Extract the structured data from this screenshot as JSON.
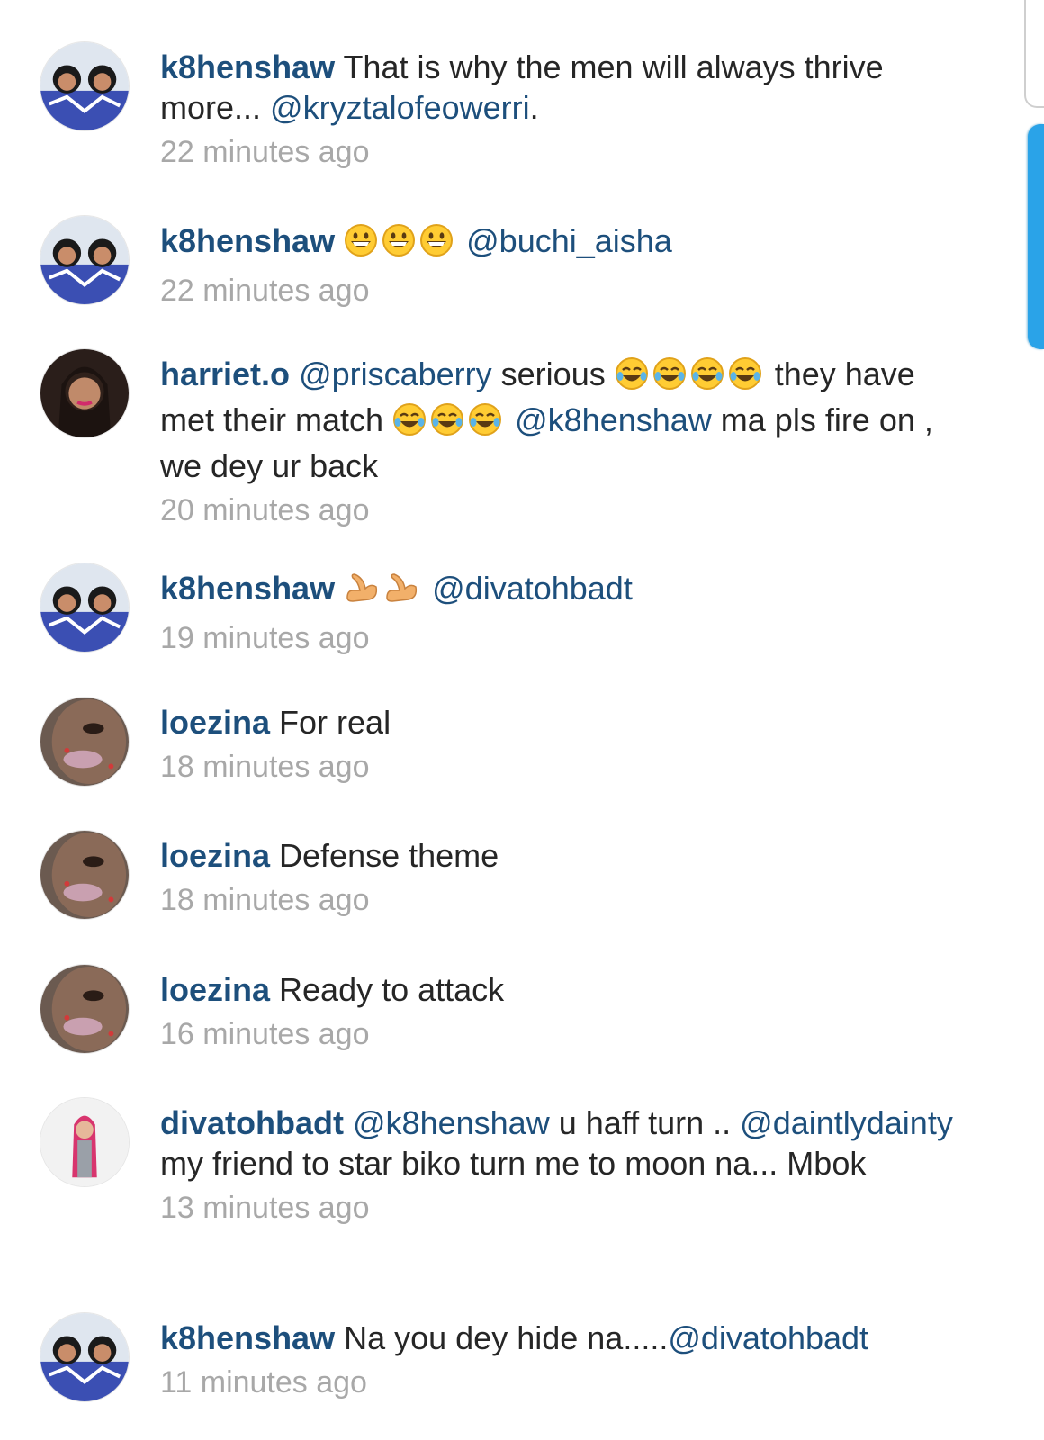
{
  "colors": {
    "username": "#1d4f7c",
    "mention": "#1d4f7c",
    "text": "#262626",
    "timestamp": "#a8a8a8",
    "scroll_thumb": "#2aa3e8"
  },
  "comments": [
    {
      "avatar": "k8henshaw-avatar",
      "user": "k8henshaw",
      "p1": " That is why the men will always thrive more... ",
      "m1": "@kryztalofeowerri",
      "p2": ".",
      "time": "22 minutes ago"
    },
    {
      "avatar": "k8henshaw-avatar",
      "user": "k8henshaw",
      "emoji": [
        "grinning-face-emoji",
        "grinning-face-emoji",
        "grinning-face-emoji"
      ],
      "m1": "@buchi_aisha",
      "time": "22 minutes ago"
    },
    {
      "avatar": "harriet-o-avatar",
      "user": "harriet.o",
      "m1": "@priscaberry",
      "p1": " serious ",
      "emoji_a": [
        "tears-of-joy-emoji",
        "tears-of-joy-emoji",
        "tears-of-joy-emoji",
        "tears-of-joy-emoji"
      ],
      "p2": " they have met their match ",
      "emoji_b": [
        "tears-of-joy-emoji",
        "tears-of-joy-emoji",
        "tears-of-joy-emoji"
      ],
      "m2": "@k8henshaw",
      "p3": " ma pls fire on , we dey ur back",
      "time": "20 minutes ago"
    },
    {
      "avatar": "k8henshaw-avatar",
      "user": "k8henshaw",
      "emoji": [
        "flexed-biceps-emoji",
        "flexed-biceps-emoji"
      ],
      "m1": "@divatohbadt",
      "time": "19 minutes ago"
    },
    {
      "avatar": "loezina-avatar",
      "user": "loezina",
      "p1": " For real",
      "time": "18 minutes ago"
    },
    {
      "avatar": "loezina-avatar",
      "user": "loezina",
      "p1": " Defense theme",
      "time": "18 minutes ago"
    },
    {
      "avatar": "loezina-avatar",
      "user": "loezina",
      "p1": " Ready to attack",
      "time": "16 minutes ago"
    },
    {
      "avatar": "divatohbadt-avatar",
      "user": "divatohbadt",
      "m1": "@k8henshaw",
      "p1": " u haff turn .. ",
      "m2": "@daintlydainty",
      "p2": " my friend to star biko turn me to moon na... Mbok",
      "time": "13 minutes ago"
    },
    {
      "avatar": "k8henshaw-avatar",
      "user": "k8henshaw",
      "p1": " Na you dey hide na.....",
      "m1": "@divatohbadt",
      "time": "11 minutes ago"
    }
  ]
}
